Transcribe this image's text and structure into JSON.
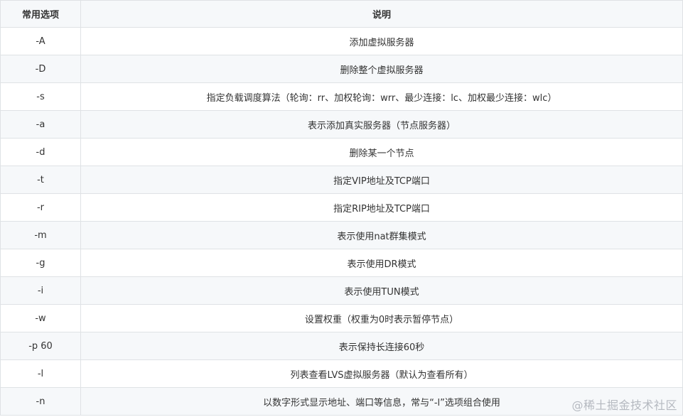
{
  "table": {
    "headers": [
      "常用选项",
      "说明"
    ],
    "rows": [
      {
        "option": "-A",
        "desc": "添加虚拟服务器"
      },
      {
        "option": "-D",
        "desc": "删除整个虚拟服务器"
      },
      {
        "option": "-s",
        "desc": "指定负载调度算法（轮询：rr、加权轮询：wrr、最少连接：lc、加权最少连接：wlc）"
      },
      {
        "option": "-a",
        "desc": "表示添加真实服务器（节点服务器）"
      },
      {
        "option": "-d",
        "desc": "删除某一个节点"
      },
      {
        "option": "-t",
        "desc": "指定VIP地址及TCP端口"
      },
      {
        "option": "-r",
        "desc": "指定RIP地址及TCP端口"
      },
      {
        "option": "-m",
        "desc": "表示使用nat群集模式"
      },
      {
        "option": "-g",
        "desc": "表示使用DR模式"
      },
      {
        "option": "-i",
        "desc": "表示使用TUN模式"
      },
      {
        "option": "-w",
        "desc": "设置权重（权重为0时表示暂停节点）"
      },
      {
        "option": "-p 60",
        "desc": "表示保持长连接60秒"
      },
      {
        "option": "-l",
        "desc": "列表查看LVS虚拟服务器（默认为查看所有）"
      },
      {
        "option": "-n",
        "desc": "以数字形式显示地址、端口等信息，常与“-l”选项组合使用"
      }
    ]
  },
  "watermark": "@稀土掘金技术社区",
  "colors": {
    "border": "#dfe2e5",
    "header_bg": "#f6f8fa",
    "text": "#333333"
  }
}
